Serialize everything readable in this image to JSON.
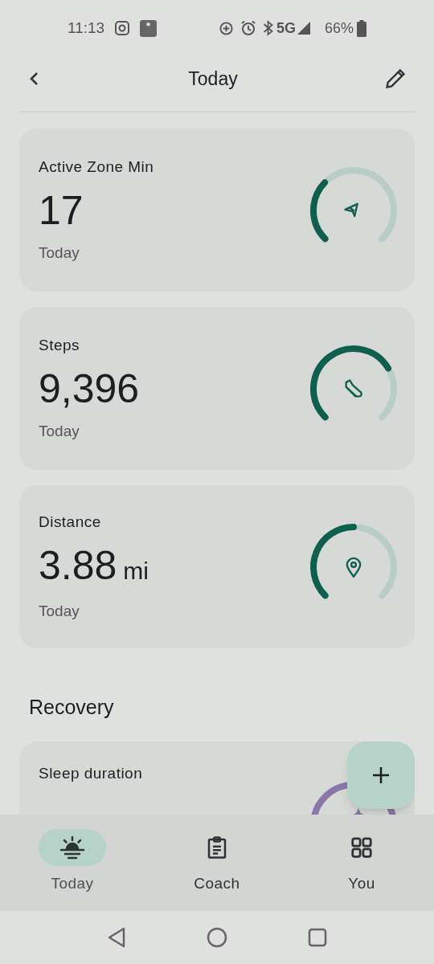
{
  "status_bar": {
    "time": "11:13",
    "battery": "66%",
    "network": "5G"
  },
  "header": {
    "title": "Today"
  },
  "cards": [
    {
      "title": "Active Zone Min",
      "value": "17",
      "caption": "Today"
    },
    {
      "title": "Steps",
      "value": "9,396",
      "caption": "Today"
    },
    {
      "title": "Distance",
      "value": "3.88",
      "unit": "mi",
      "caption": "Today"
    }
  ],
  "section": {
    "title": "Recovery"
  },
  "partial_card": {
    "title": "Sleep duration"
  },
  "nav": [
    {
      "label": "Today",
      "selected": true
    },
    {
      "label": "Coach",
      "selected": false
    },
    {
      "label": "You",
      "selected": false
    }
  ]
}
